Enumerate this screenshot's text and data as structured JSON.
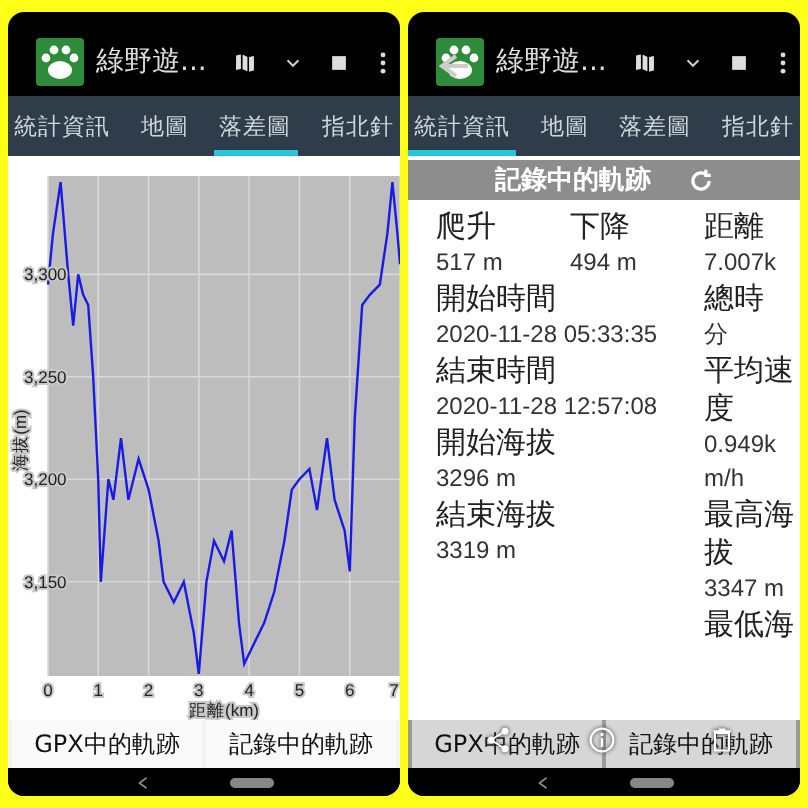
{
  "panels": [
    {
      "app_title": "綠野遊...",
      "back": false,
      "tabs": [
        {
          "label": "統計資訊",
          "selected": false
        },
        {
          "label": "地圖",
          "selected": false
        },
        {
          "label": "落差圖",
          "selected": true
        },
        {
          "label": "指北針",
          "selected": false
        }
      ],
      "kind": "chart",
      "chart_data": {
        "type": "line",
        "xlabel": "距離(km)",
        "ylabel": "海拔(m)",
        "x": [
          0,
          0.1,
          0.25,
          0.4,
          0.5,
          0.6,
          0.7,
          0.8,
          0.9,
          1.0,
          1.05,
          1.2,
          1.3,
          1.45,
          1.6,
          1.8,
          2.0,
          2.2,
          2.3,
          2.5,
          2.7,
          2.9,
          3.0,
          3.15,
          3.3,
          3.5,
          3.65,
          3.8,
          3.9,
          4.1,
          4.3,
          4.5,
          4.7,
          4.85,
          5.0,
          5.2,
          5.35,
          5.55,
          5.7,
          5.9,
          6.0,
          6.1,
          6.25,
          6.4,
          6.6,
          6.75,
          6.85,
          6.95,
          7.0
        ],
        "series": [
          {
            "color": "#1a1ae6",
            "values": [
              3295,
              3320,
              3345,
              3300,
              3275,
              3300,
              3290,
              3285,
              3250,
              3200,
              3150,
              3200,
              3190,
              3220,
              3190,
              3210,
              3195,
              3170,
              3150,
              3140,
              3150,
              3125,
              3105,
              3150,
              3170,
              3160,
              3175,
              3130,
              3110,
              3120,
              3130,
              3145,
              3170,
              3195,
              3200,
              3205,
              3185,
              3220,
              3190,
              3175,
              3155,
              3230,
              3285,
              3290,
              3295,
              3320,
              3345,
              3320,
              3305
            ]
          }
        ],
        "xlim": [
          0,
          7
        ],
        "ylim": [
          3104,
          3348
        ],
        "grid": true,
        "xticks": [
          0,
          1,
          2,
          3,
          4,
          5,
          6,
          7
        ],
        "yticks": [
          {
            "value": 3150,
            "label": "3,150"
          },
          {
            "value": 3200,
            "label": "3,200"
          },
          {
            "value": 3250,
            "label": "3,250"
          },
          {
            "value": 3300,
            "label": "3,300"
          }
        ]
      },
      "buttons": [
        "GPX中的軌跡",
        "記錄中的軌跡"
      ],
      "overlay_icons": false
    },
    {
      "app_title": "綠野遊...",
      "back": true,
      "tabs": [
        {
          "label": "統計資訊",
          "selected": true
        },
        {
          "label": "地圖",
          "selected": false
        },
        {
          "label": "落差圖",
          "selected": false
        },
        {
          "label": "指北針",
          "selected": false
        }
      ],
      "kind": "stats",
      "section_title": "記錄中的軌跡",
      "summary": [
        {
          "label": "爬升",
          "value": "517 m"
        },
        {
          "label": "下降",
          "value": "494 m"
        }
      ],
      "details": [
        {
          "label": "開始時間",
          "value": "2020-11-28 05:33:35"
        },
        {
          "label": "結束時間",
          "value": "2020-11-28 12:57:08"
        },
        {
          "label": "開始海拔",
          "value": "3296 m"
        },
        {
          "label": "結束海拔",
          "value": "3319 m"
        }
      ],
      "side": [
        {
          "kind": "label",
          "text": "距離"
        },
        {
          "kind": "value",
          "text": "7.007k"
        },
        {
          "kind": "label",
          "text": "總時"
        },
        {
          "kind": "value",
          "text": "分"
        },
        {
          "kind": "label",
          "text": "平均速度"
        },
        {
          "kind": "value",
          "text": "0.949km/h"
        },
        {
          "kind": "label",
          "text": "最高海拔"
        },
        {
          "kind": "value",
          "text": "3347 m"
        },
        {
          "kind": "label",
          "text": "最低海"
        }
      ],
      "buttons": [
        "GPX中的軌跡",
        "記錄中的軌跡"
      ],
      "overlay_icons": true
    }
  ]
}
